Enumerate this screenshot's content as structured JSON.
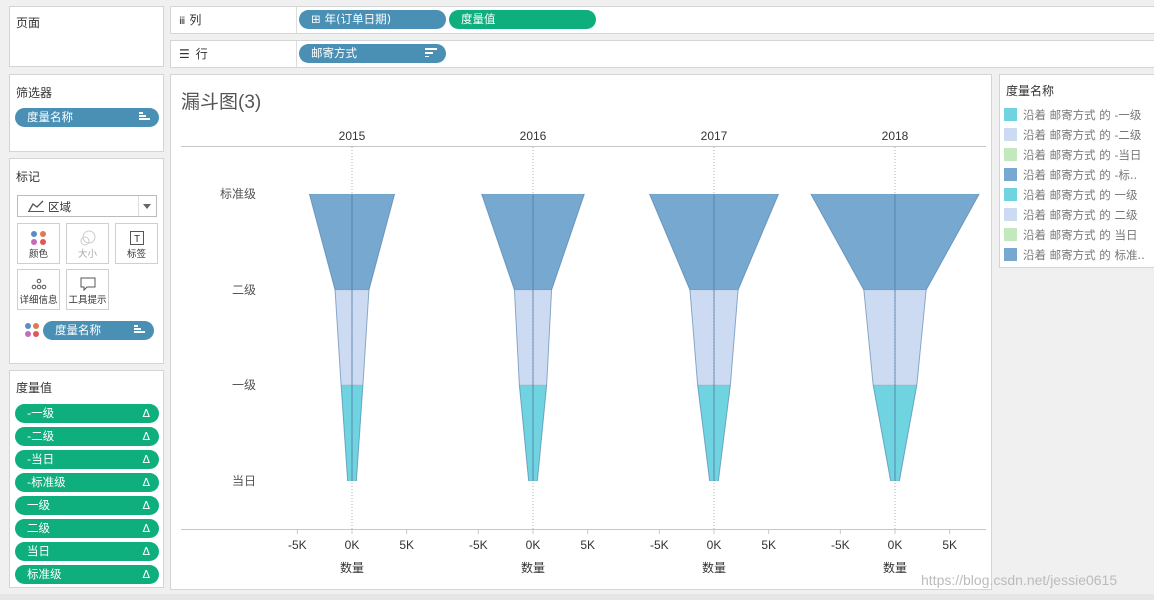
{
  "pages_card": {
    "title": "页面"
  },
  "columns_shelf": {
    "icon": "columns-icon",
    "label": "列",
    "pills": [
      "年(订单日期)",
      "度量值"
    ],
    "date_pill_prefix": "⊞"
  },
  "rows_shelf": {
    "icon": "rows-icon",
    "label": "行",
    "pills": [
      "邮寄方式"
    ]
  },
  "filters_card": {
    "title": "筛选器",
    "pill": "度量名称"
  },
  "marks_card": {
    "title": "标记",
    "mark_type": "区域",
    "buttons": [
      "颜色",
      "大小",
      "标签",
      "详细信息",
      "工具提示"
    ],
    "color_pill": "度量名称"
  },
  "measure_values_card": {
    "title": "度量值",
    "delta_symbol": "Δ",
    "pills": [
      "-一级",
      "-二级",
      "-当日",
      "-标准级",
      "一级",
      "二级",
      "当日",
      "标准级"
    ]
  },
  "legend": {
    "title": "度量名称",
    "items": [
      {
        "label": "沿着 邮寄方式 的 -一级",
        "color": "#6fd3e0"
      },
      {
        "label": "沿着 邮寄方式 的 -二级",
        "color": "#cddbf2"
      },
      {
        "label": "沿着 邮寄方式 的 -当日",
        "color": "#c4e8bd"
      },
      {
        "label": "沿着 邮寄方式 的 -标..",
        "color": "#77a9d0"
      },
      {
        "label": "沿着 邮寄方式 的 一级",
        "color": "#6fd3e0"
      },
      {
        "label": "沿着 邮寄方式 的 二级",
        "color": "#cddbf2"
      },
      {
        "label": "沿着 邮寄方式 的 当日",
        "color": "#c4e8bd"
      },
      {
        "label": "沿着 邮寄方式 的 标准..",
        "color": "#77a9d0"
      }
    ]
  },
  "chart_data": {
    "type": "area",
    "title": "漏斗图(3)",
    "xlabel": "数量",
    "x_ticks": [
      "-5K",
      "0K",
      "5K"
    ],
    "xlim": [
      -7500,
      7500
    ],
    "y_categories": [
      "标准级",
      "二级",
      "一级",
      "当日"
    ],
    "colors": {
      "标准级": "#77a9d0",
      "二级": "#cddbf2",
      "一级": "#6fd3e0",
      "当日": "#6fd3e0"
    },
    "panels": [
      {
        "year": "2015",
        "values": {
          "标准级": 3900,
          "二级": 1550,
          "一级": 1000,
          "当日": 400
        }
      },
      {
        "year": "2016",
        "values": {
          "标准级": 4700,
          "二级": 1700,
          "一级": 1250,
          "当日": 400
        }
      },
      {
        "year": "2017",
        "values": {
          "标准级": 5900,
          "二级": 2200,
          "一级": 1500,
          "当日": 400
        }
      },
      {
        "year": "2018",
        "values": {
          "标准级": 7700,
          "二级": 2850,
          "一级": 2000,
          "当日": 400
        }
      }
    ]
  },
  "watermark": "https://blog.csdn.net/jessie0615"
}
